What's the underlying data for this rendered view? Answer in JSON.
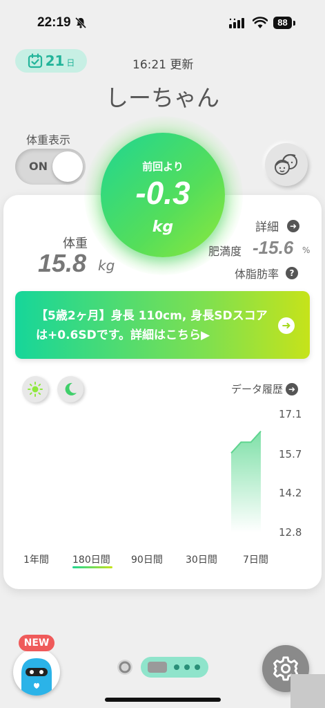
{
  "status_bar": {
    "time": "22:19",
    "battery": "88"
  },
  "header": {
    "day_count": "21",
    "day_unit": "日",
    "update_time": "16:21 更新",
    "profile_name": "しーちゃん"
  },
  "weight_display": {
    "label": "体重表示",
    "toggle_state": "ON"
  },
  "change": {
    "since_label": "前回より",
    "value": "-0.3",
    "unit": "kg"
  },
  "weight": {
    "label": "体重",
    "value": "15.8",
    "unit": "kg"
  },
  "stats": {
    "detail_label": "詳細",
    "obesity_label": "肥満度",
    "obesity_value": "-15.6",
    "obesity_unit": "%",
    "bodyfat_label": "体脂肪率"
  },
  "banner": {
    "text": "【5歳2ヶ月】身長 110cm, 身長SDスコアは+0.6SDです。詳細はこちら▶"
  },
  "chart_controls": {
    "history_label": "データ履歴"
  },
  "chart_data": {
    "type": "area",
    "y_ticks": [
      "17.1",
      "15.7",
      "14.2",
      "12.8"
    ],
    "ylim": [
      12.8,
      17.1
    ],
    "x": [
      "",
      "",
      "",
      ""
    ],
    "values": [
      15.7,
      16.1,
      16.1,
      16.5
    ],
    "title": "",
    "xlabel": "",
    "ylabel": "",
    "color_top": "#7fe0a8",
    "color_bottom": "#ffffff"
  },
  "period_tabs": [
    {
      "label": "1年間",
      "selected": false
    },
    {
      "label": "180日間",
      "selected": true
    },
    {
      "label": "90日間",
      "selected": false
    },
    {
      "label": "30日間",
      "selected": false
    },
    {
      "label": "7日間",
      "selected": false
    }
  ],
  "footer": {
    "new_badge": "NEW"
  },
  "colors": {
    "accent_green": "#1fd692",
    "accent_lime": "#c6e31a",
    "badge_red": "#ef5a5a"
  }
}
